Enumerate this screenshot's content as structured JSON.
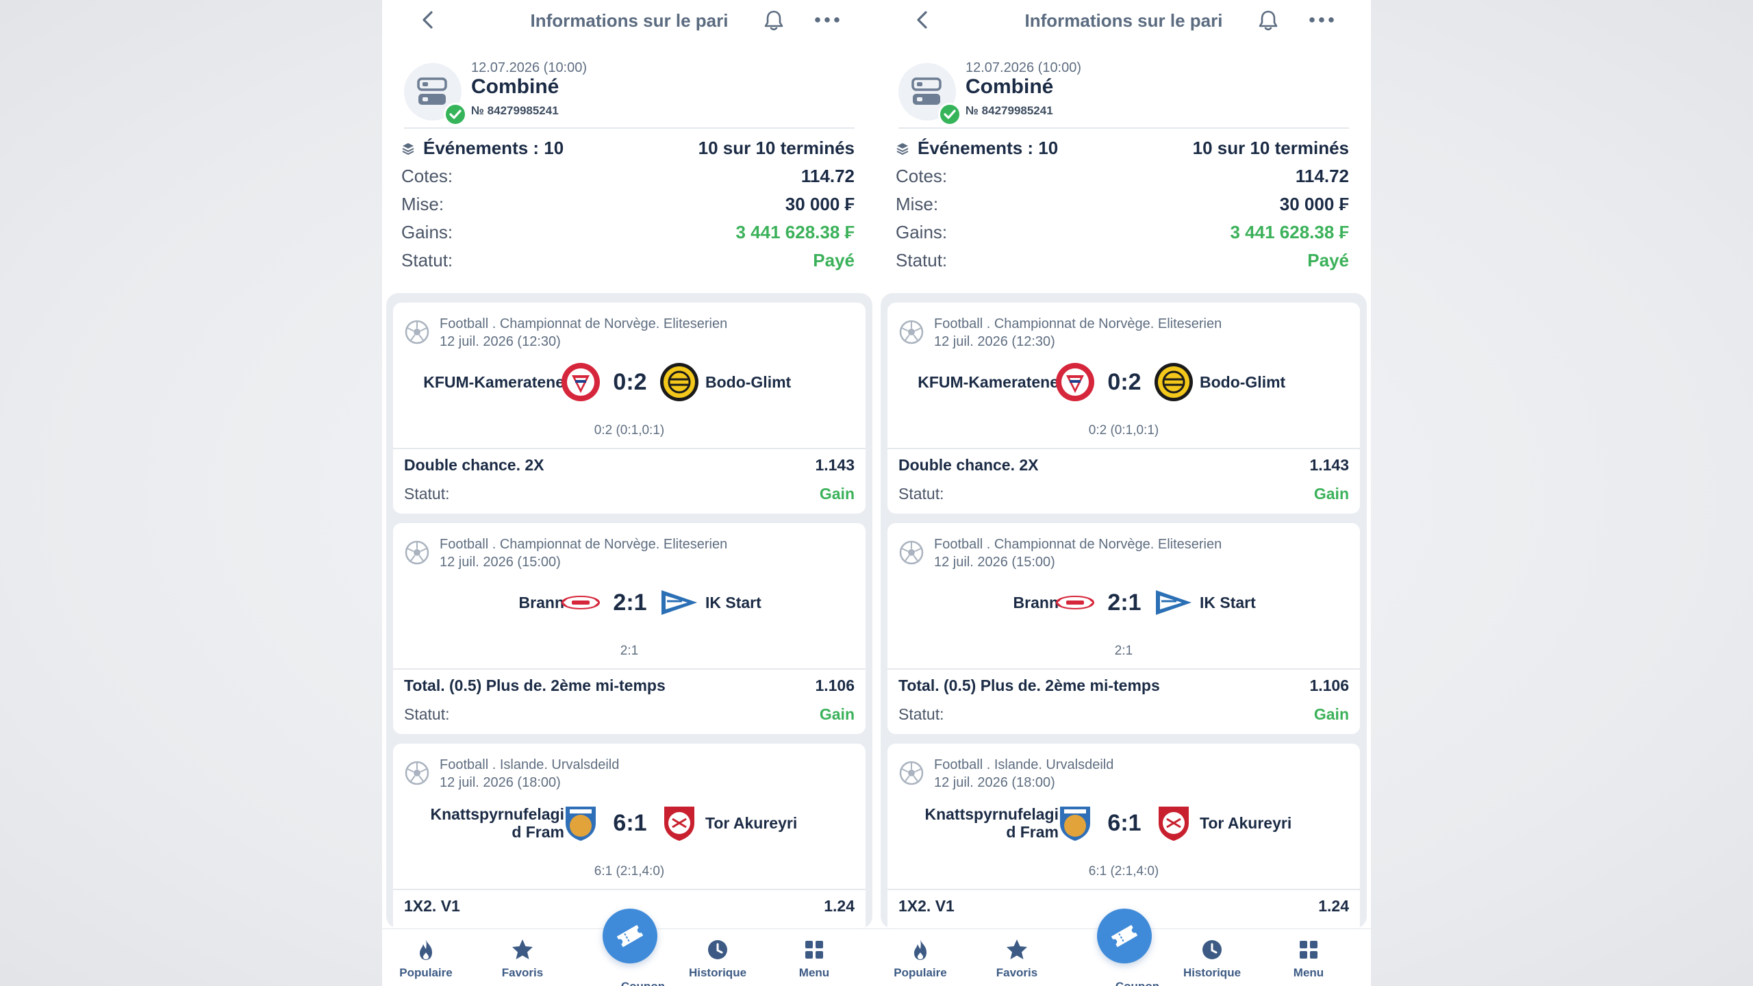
{
  "header": {
    "title": "Informations sur le pari"
  },
  "bet": {
    "date": "12.07.2026 (10:00)",
    "type": "Combiné",
    "number": "№ 84279985241"
  },
  "summary": {
    "events_label": "Événements : 10",
    "events_done": "10 sur 10 terminés",
    "odds_label": "Cotes:",
    "odds_value": "114.72",
    "stake_label": "Mise:",
    "stake_value": "30 000 ₣",
    "winnings_label": "Gains:",
    "winnings_value": "3 441 628.38 ₣",
    "status_label": "Statut:",
    "status_value": "Payé"
  },
  "events": [
    {
      "league": "Football . Championnat de Norvège. Eliteserien",
      "datetime": "12 juil. 2026 (12:30)",
      "home": "KFUM-Kameratene",
      "away": "Bodo-Glimt",
      "score": "0:2",
      "score_detail": "0:2 (0:1,0:1)",
      "market": "Double chance. 2X",
      "odds": "1.143",
      "status_label": "Statut:",
      "status": "Gain"
    },
    {
      "league": "Football . Championnat de Norvège. Eliteserien",
      "datetime": "12 juil. 2026 (15:00)",
      "home": "Brann",
      "away": "IK Start",
      "score": "2:1",
      "score_detail": "2:1",
      "market": "Total. (0.5) Plus de. 2ème mi-temps",
      "odds": "1.106",
      "status_label": "Statut:",
      "status": "Gain"
    },
    {
      "league": "Football . Islande. Urvalsdeild",
      "datetime": "12 juil. 2026 (18:00)",
      "home_line1": "Knattspyrnufelagi",
      "home_line2": "d Fram",
      "away": "Tor Akureyri",
      "score": "6:1",
      "score_detail": "6:1 (2:1,4:0)",
      "market": "1X2. V1",
      "odds": "1.24"
    }
  ],
  "nav": {
    "popular": "Populaire",
    "favorites": "Favoris",
    "coupon": "Coupon",
    "history": "Historique",
    "menu": "Menu"
  },
  "colors": {
    "accent_blue": "#3f8bd9",
    "nav_text": "#3c5a84",
    "win_green": "#3bb15a",
    "text_dark": "#1b2b45"
  },
  "icons": [
    "back-icon",
    "bell-icon",
    "more-icon",
    "bet-stack-icon",
    "check-icon",
    "layers-icon",
    "football-icon",
    "fire-icon",
    "star-icon",
    "ticket-icon",
    "clock-icon",
    "grid-icon"
  ]
}
